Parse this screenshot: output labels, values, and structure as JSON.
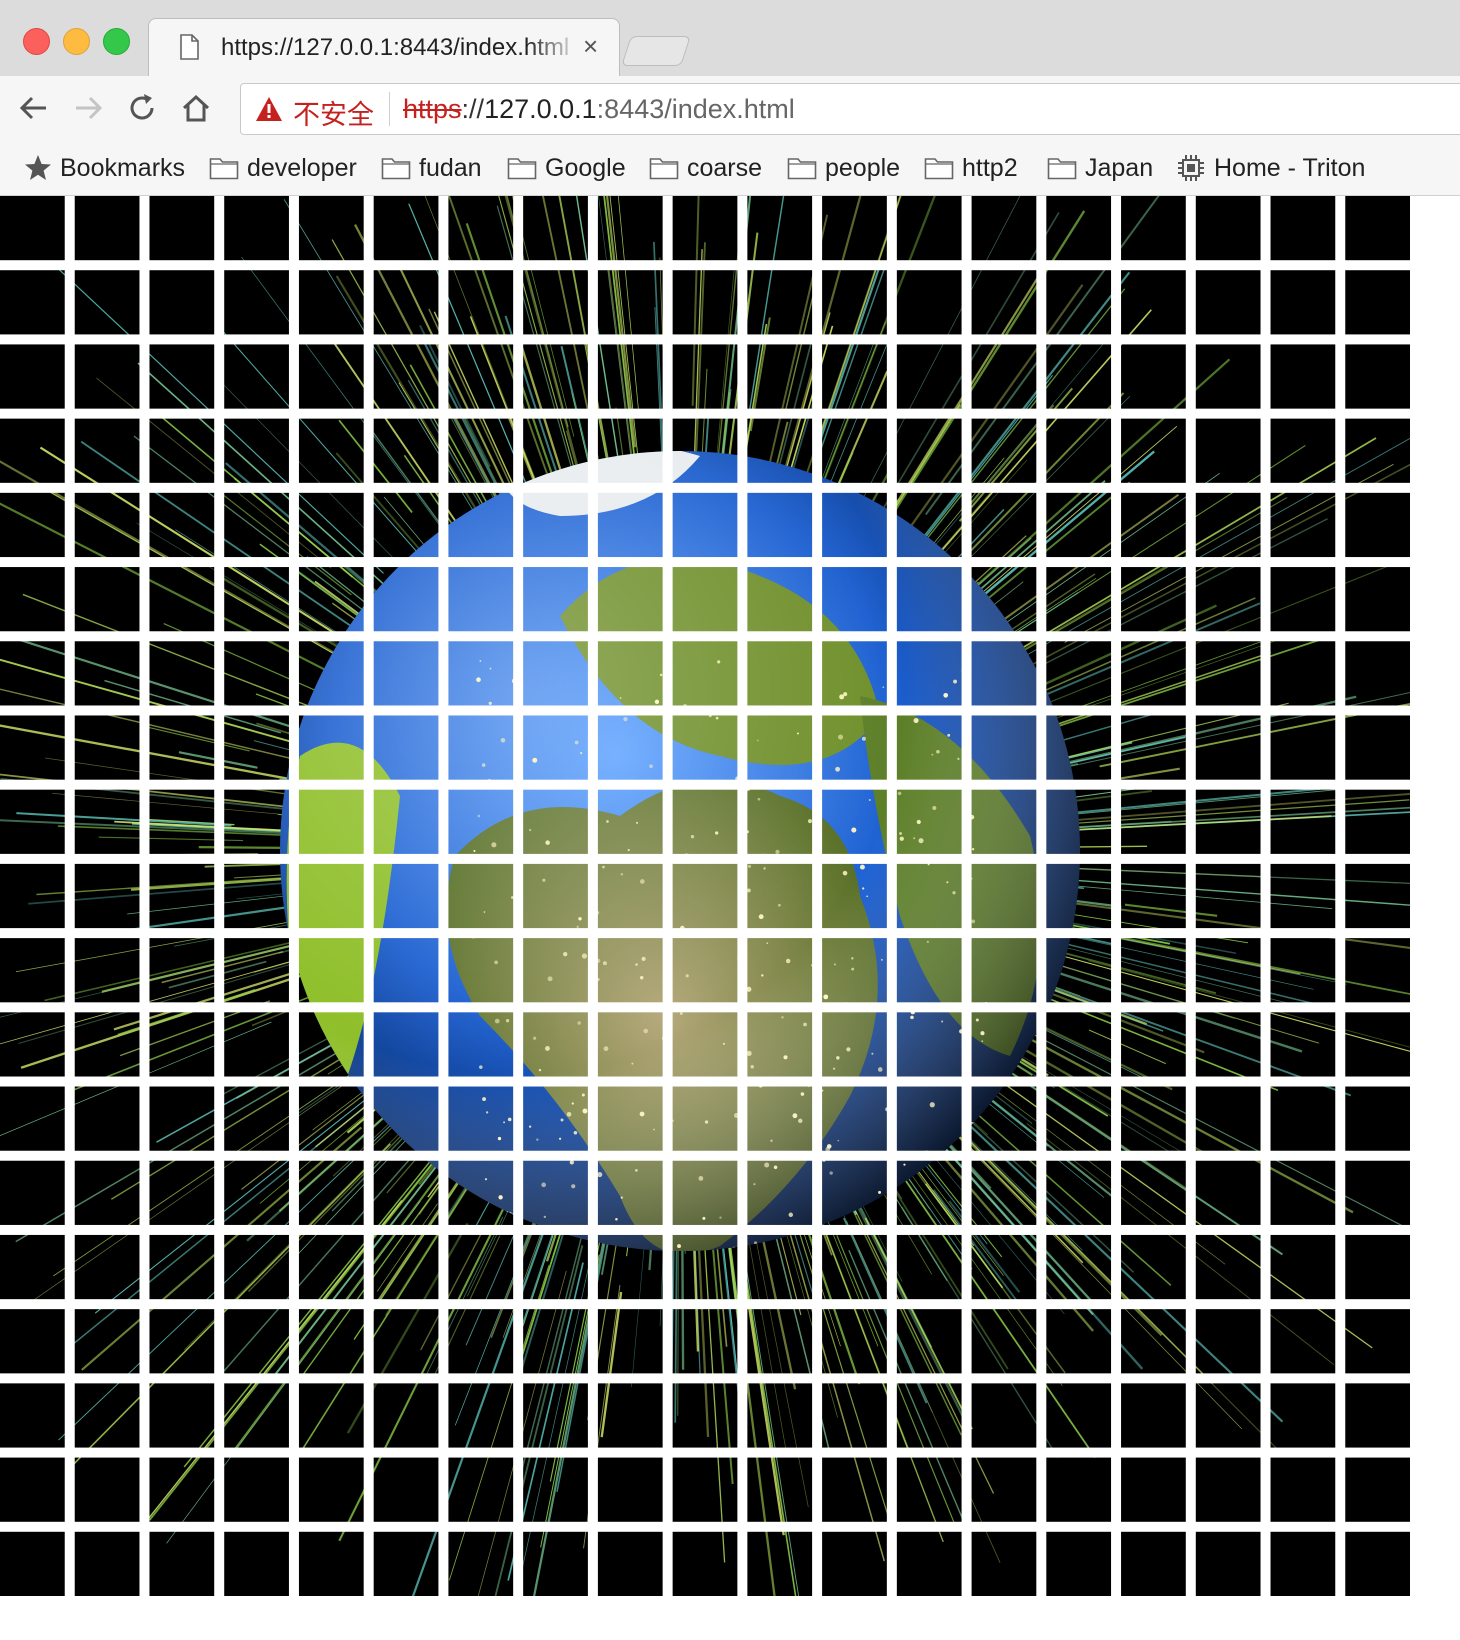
{
  "window": {
    "tab_title": "https://127.0.0.1:8443/index.html",
    "tab_close_label": "×"
  },
  "toolbar": {
    "security_label": "不安全",
    "url_scheme": "https",
    "url_separator": "://",
    "url_host": "127.0.0.1",
    "url_rest": ":8443/index.html"
  },
  "bookmarks": {
    "items": [
      {
        "label": "Bookmarks",
        "icon": "star-icon"
      },
      {
        "label": "developer",
        "icon": "folder-icon"
      },
      {
        "label": "fudan",
        "icon": "folder-icon"
      },
      {
        "label": "Google",
        "icon": "folder-icon"
      },
      {
        "label": "coarse",
        "icon": "folder-icon"
      },
      {
        "label": "people",
        "icon": "folder-icon"
      },
      {
        "label": "http2",
        "icon": "folder-icon"
      },
      {
        "label": "Japan",
        "icon": "folder-icon"
      },
      {
        "label": "Home - Triton",
        "icon": "chip-icon"
      }
    ]
  },
  "scene": {
    "grid_rows": 19,
    "grid_cols": 19,
    "colors": {
      "background": "#000000",
      "grid_lines": "#ffffff",
      "ocean": "#1c5fd0",
      "land": "#6f8f2a",
      "rays": "#b6e05a"
    }
  }
}
